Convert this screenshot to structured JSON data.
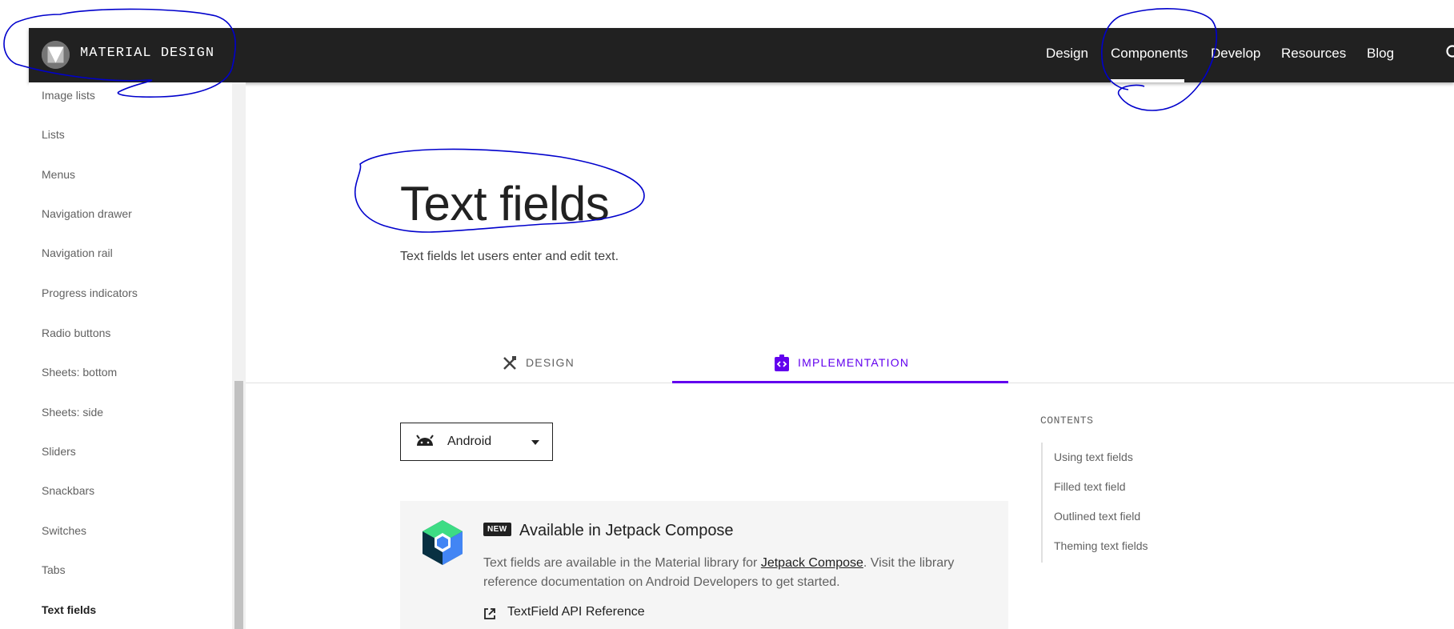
{
  "header": {
    "brand": "MATERIAL DESIGN",
    "nav": [
      "Design",
      "Components",
      "Develop",
      "Resources",
      "Blog"
    ],
    "active_nav": "Components"
  },
  "sidebar": {
    "items": [
      "Image lists",
      "Lists",
      "Menus",
      "Navigation drawer",
      "Navigation rail",
      "Progress indicators",
      "Radio buttons",
      "Sheets: bottom",
      "Sheets: side",
      "Sliders",
      "Snackbars",
      "Switches",
      "Tabs",
      "Text fields"
    ],
    "active": "Text fields"
  },
  "main": {
    "title": "Text fields",
    "subtitle": "Text fields let users enter and edit text.",
    "tabs": [
      "DESIGN",
      "IMPLEMENTATION"
    ],
    "active_tab": "IMPLEMENTATION",
    "platform_select": "Android",
    "compose": {
      "badge": "NEW",
      "title": "Available in Jetpack Compose",
      "body_pre": "Text fields are available in the Material library for ",
      "body_link": "Jetpack Compose",
      "body_post": ". Visit the library reference documentation on Android Developers to get started.",
      "link": "TextField API Reference"
    }
  },
  "contents": {
    "heading": "CONTENTS",
    "items": [
      "Using text fields",
      "Filled text field",
      "Outlined text field",
      "Theming text fields"
    ]
  },
  "colors": {
    "topbar": "#212121",
    "accent": "#6200ee",
    "annotation": "#0000cc"
  },
  "icons": [
    "material-logo-icon",
    "search-icon",
    "design-tools-icon",
    "implementation-code-icon",
    "android-icon",
    "dropdown-arrow-icon",
    "jetpack-compose-logo-icon",
    "open-in-new-icon"
  ]
}
